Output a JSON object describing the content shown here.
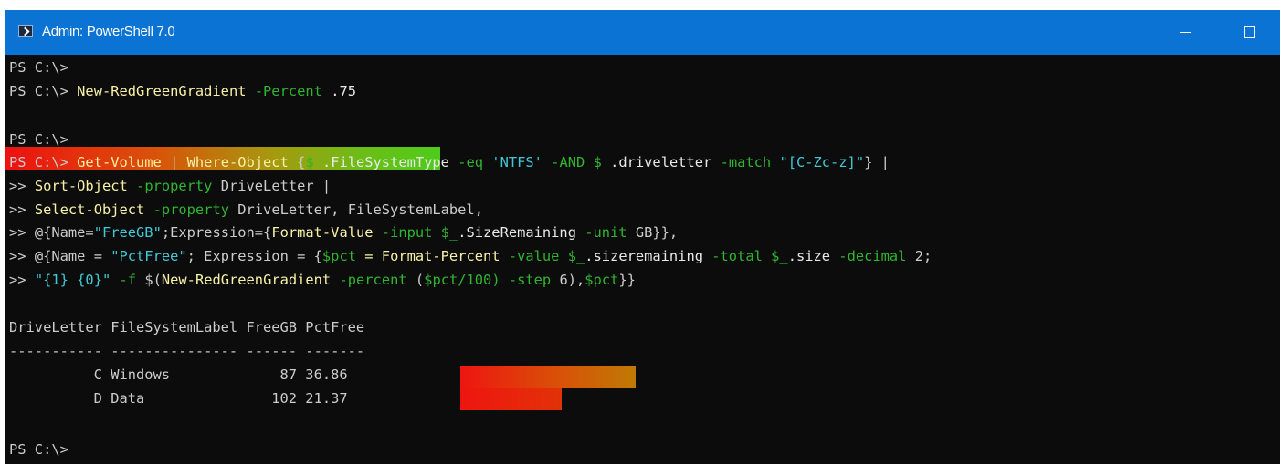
{
  "window": {
    "title": "Admin: PowerShell 7.0",
    "colors": {
      "titlebar": "#0a73d3",
      "console_bg": "#0c0c0c"
    }
  },
  "console": {
    "prompt1": "PS C:\\>",
    "prompt2": "PS C:\\>",
    "cmd1": {
      "command": "New-RedGreenGradient",
      "param": "-Percent",
      "value": ".75"
    },
    "gradient_fraction": 0.75,
    "prompt3": "PS C:\\>",
    "prompt4": "PS C:\\>",
    "pipeline": {
      "l1_cmd": "Get-Volume",
      "l1_pipe": " | ",
      "l1_where": "Where-Object",
      "l1_open": " {",
      "l1_var1": "$_",
      "l1_prop1": ".FileSystemType ",
      "l1_eq": "-eq",
      "l1_str1": "'NTFS'",
      "l1_and": "-AND",
      "l1_var2": "$_",
      "l1_prop2": ".driveletter ",
      "l1_match": "-match",
      "l1_str2": "\"[C-Zc-z]\"",
      "l1_close": "} |",
      "cont": ">>",
      "l2_cmd": "Sort-Object",
      "l2_param": "-property",
      "l2_rest": " DriveLetter |",
      "l3_cmd": "Select-Object",
      "l3_param": "-property",
      "l3_rest": " DriveLetter, FileSystemLabel,",
      "l4_a": "@{Name=",
      "l4_str": "\"FreeGB\"",
      "l4_b": ";Expression={",
      "l4_cmd": "Format-Value",
      "l4_param1": "-input",
      "l4_var": "$_",
      "l4_prop": ".SizeRemaining ",
      "l4_param2": "-unit",
      "l4_c": " GB}},",
      "l5_a": "@{Name = ",
      "l5_str": "\"PctFree\"",
      "l5_b": "; Expression = {",
      "l5_var1": "$pct",
      "l5_eq": " = ",
      "l5_cmd": "Format-Percent",
      "l5_param1": "-value",
      "l5_var2": "$_",
      "l5_prop1": ".sizeremaining ",
      "l5_param2": "-total",
      "l5_var3": "$_",
      "l5_prop2": ".size ",
      "l5_param3": "-decimal",
      "l5_c": " 2;",
      "l6_str": "\"{1} {0}\"",
      "l6_param1": "-f",
      "l6_a": " $(",
      "l6_cmd": "New-RedGreenGradient",
      "l6_param2": "-percent",
      "l6_b": " (",
      "l6_var1": "$pct",
      "l6_c": "/100) ",
      "l6_param3": "-step",
      "l6_d": " 6),",
      "l6_var2": "$pct",
      "l6_e": "}}"
    },
    "table": {
      "headers": "DriveLetter FileSystemLabel FreeGB PctFree",
      "separators": "----------- --------------- ------ -------",
      "rows": [
        {
          "drive": "C",
          "label": "Windows",
          "free_gb": "87",
          "pct_free": "36.86",
          "bar_fraction": 0.3686
        },
        {
          "drive": "D",
          "label": "Data",
          "free_gb": "102",
          "pct_free": "21.37",
          "bar_fraction": 0.2137
        }
      ]
    },
    "prompt_final": "PS C:\\>"
  }
}
